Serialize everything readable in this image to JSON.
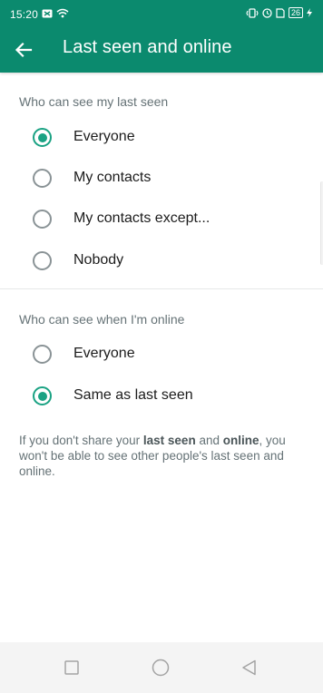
{
  "status_bar": {
    "time": "15:20",
    "battery": "26"
  },
  "app_bar": {
    "title": "Last seen and online",
    "color": "#0b8a6e"
  },
  "last_seen": {
    "heading": "Who can see my last seen",
    "options": [
      {
        "label": "Everyone",
        "selected": true
      },
      {
        "label": "My contacts",
        "selected": false
      },
      {
        "label": "My contacts except...",
        "selected": false
      },
      {
        "label": "Nobody",
        "selected": false
      }
    ]
  },
  "online": {
    "heading": "Who can see when I'm online",
    "options": [
      {
        "label": "Everyone",
        "selected": false
      },
      {
        "label": "Same as last seen",
        "selected": true
      }
    ]
  },
  "info": {
    "part1": "If you don't share your ",
    "bold1": "last seen",
    "part2": " and ",
    "bold2": "online",
    "part3": ", you won't be able to see other people's last seen and online."
  },
  "icons": {
    "back": "arrow-left-icon",
    "nav_recents": "square-icon",
    "nav_home": "circle-icon",
    "nav_back": "triangle-back-icon"
  },
  "accent_color": "#1aa283"
}
